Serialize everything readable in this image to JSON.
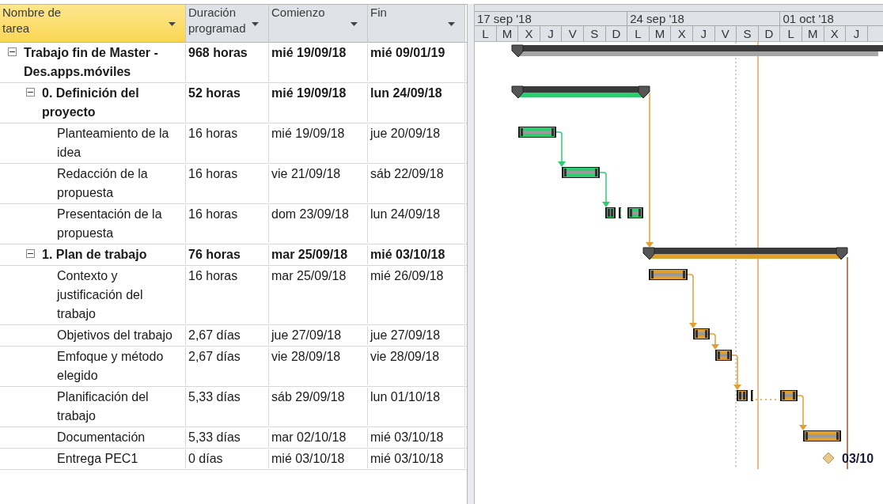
{
  "columns": [
    {
      "label": "Nombre de tarea",
      "selected": true
    },
    {
      "label": "Duración programad",
      "selected": false
    },
    {
      "label": "Comienzo",
      "selected": false
    },
    {
      "label": "Fin",
      "selected": false
    }
  ],
  "timescale": {
    "weeks": [
      "17 sep '18",
      "24 sep '18",
      "01 oct '18"
    ],
    "days": [
      "L",
      "M",
      "X",
      "J",
      "V",
      "S",
      "D",
      "L",
      "M",
      "X",
      "J",
      "V",
      "S",
      "D",
      "L",
      "M",
      "X",
      "J"
    ]
  },
  "tasks": [
    {
      "kind": "summary",
      "name": "Trabajo fin de Master - Des.apps.móviles",
      "duration": "968 horas",
      "start": "mié 19/09/18",
      "end": "mié 09/01/19",
      "expanded": true,
      "color": "#a6a6a6",
      "children": [
        {
          "kind": "summary",
          "name": "0. Definición del proyecto",
          "duration": "52 horas",
          "start": "mié 19/09/18",
          "end": "lun 24/09/18",
          "expanded": true,
          "color": "#2ecc71",
          "children": [
            {
              "kind": "task",
              "name": "Planteamiento de la idea",
              "duration": "16 horas",
              "start": "mié 19/09/18",
              "end": "jue 20/09/18"
            },
            {
              "kind": "task",
              "name": "Redacción de la propuesta",
              "duration": "16 horas",
              "start": "vie 21/09/18",
              "end": "sáb 22/09/18"
            },
            {
              "kind": "task",
              "name": "Presentación de la propuesta",
              "duration": "16 horas",
              "start": "dom 23/09/18",
              "end": "lun 24/09/18"
            }
          ]
        },
        {
          "kind": "summary",
          "name": "1. Plan de trabajo",
          "duration": "76 horas",
          "start": "mar 25/09/18",
          "end": "mié 03/10/18",
          "expanded": true,
          "color": "#e0a030",
          "children": [
            {
              "kind": "task",
              "name": "Contexto y justificación del trabajo",
              "duration": "16 horas",
              "start": "mar 25/09/18",
              "end": "mié 26/09/18"
            },
            {
              "kind": "task",
              "name": "Objetivos del trabajo",
              "duration": "2,67 días",
              "start": "jue 27/09/18",
              "end": "jue 27/09/18"
            },
            {
              "kind": "task",
              "name": "Emfoque y método elegido",
              "duration": "2,67 días",
              "start": "vie 28/09/18",
              "end": "vie 28/09/18"
            },
            {
              "kind": "task",
              "name": "Planificación del trabajo",
              "duration": "5,33 días",
              "start": "sáb 29/09/18",
              "end": "lun 01/10/18"
            },
            {
              "kind": "task",
              "name": "Documentación",
              "duration": "5,33 días",
              "start": "mar 02/10/18",
              "end": "mié 03/10/18"
            },
            {
              "kind": "milestone",
              "name": "Entrega PEC1",
              "duration": "0 días",
              "start": "mié 03/10/18",
              "end": "mié 03/10/18",
              "milestone_label": "03/10"
            }
          ]
        }
      ]
    }
  ]
}
